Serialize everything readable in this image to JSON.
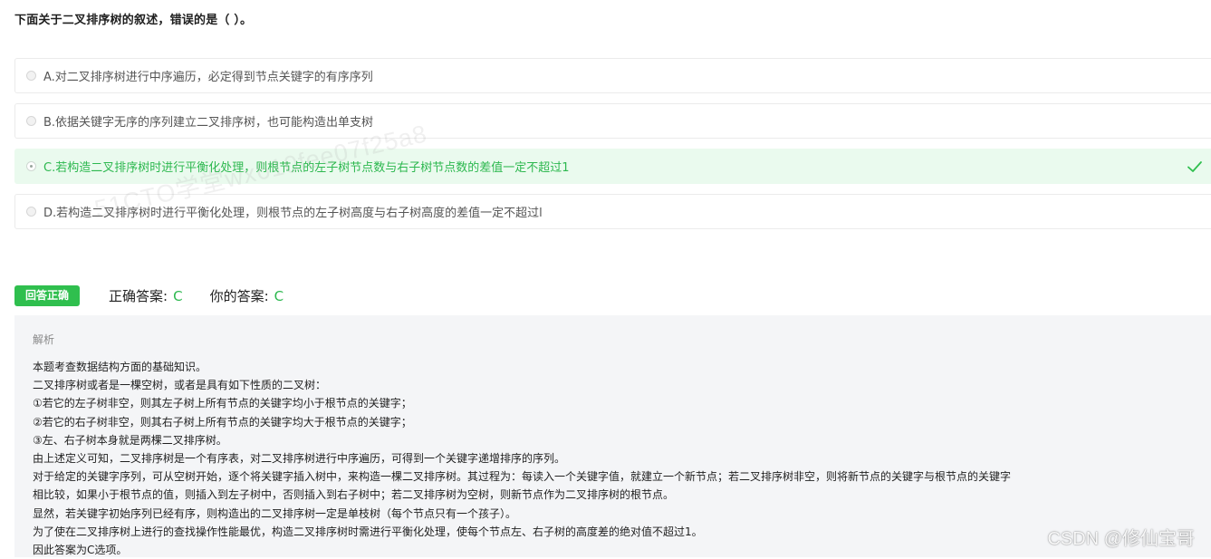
{
  "question": {
    "text": "下面关于二叉排序树的叙述，错误的是（     ）。"
  },
  "options": [
    {
      "label": "A.对二叉排序树进行中序遍历，必定得到节点关键字的有序序列",
      "selected": false,
      "correct": false
    },
    {
      "label": "B.依据关键字无序的序列建立二叉排序树，也可能构造出单支树",
      "selected": false,
      "correct": false
    },
    {
      "label": "C.若构造二叉排序树时进行平衡化处理，则根节点的左子树节点数与右子树节点数的差值一定不超过1",
      "selected": true,
      "correct": true
    },
    {
      "label": "D.若构造二叉排序树时进行平衡化处理，则根节点的左子树高度与右子树高度的差值一定不超过l",
      "selected": false,
      "correct": false
    }
  ],
  "watermark": "51CTO学堂wx610fee07f25a8",
  "result": {
    "badge": "回答正确",
    "correct_label": "正确答案:",
    "correct_value": "C",
    "your_label": "你的答案:",
    "your_value": "C"
  },
  "analysis": {
    "title": "解析",
    "lines": [
      "本题考查数据结构方面的基础知识。",
      "二叉排序树或者是一棵空树，或者是具有如下性质的二叉树：",
      "①若它的左子树非空，则其左子树上所有节点的关键字均小于根节点的关键字；",
      "②若它的右子树非空，则其右子树上所有节点的关键字均大于根节点的关键字；",
      "③左、右子树本身就是两棵二叉排序树。",
      "由上述定义可知，二叉排序树是一个有序表，对二叉排序树进行中序遍历，可得到一个关键字递增排序的序列。",
      "对于给定的关键字序列，可从空树开始，逐个将关键字插入树中，来构造一棵二叉排序树。其过程为：每读入一个关键字值，就建立一个新节点；若二叉排序树非空，则将新节点的关键字与根节点的关键字",
      "相比较，如果小于根节点的值，则插入到左子树中，否则插入到右子树中；若二叉排序树为空树，则新节点作为二叉排序树的根节点。",
      "显然，若关键字初始序列已经有序，则构造出的二叉排序树一定是单枝树（每个节点只有一个孩子）。",
      "为了使在二叉排序树上进行的查找操作性能最优，构造二叉排序树时需进行平衡化处理，使每个节点左、右子树的高度差的绝对值不超过1。",
      "因此答案为C选项。"
    ]
  },
  "csdn_watermark": "CSDN @修仙宝哥",
  "colors": {
    "accent_green": "#2fbf4e",
    "correct_bg": "#eafaee",
    "analysis_bg": "#f4f5f7"
  },
  "icons": {
    "check": "check-icon"
  }
}
